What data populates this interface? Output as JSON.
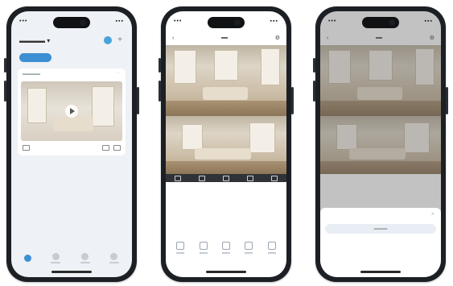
{
  "phone1": {
    "tabs": [
      "",
      "",
      ""
    ],
    "nav": [
      "",
      "",
      "",
      ""
    ]
  },
  "phone2": {
    "tools": [
      "",
      "",
      "",
      "",
      ""
    ]
  },
  "phone3": {
    "options": [
      "",
      ""
    ]
  }
}
